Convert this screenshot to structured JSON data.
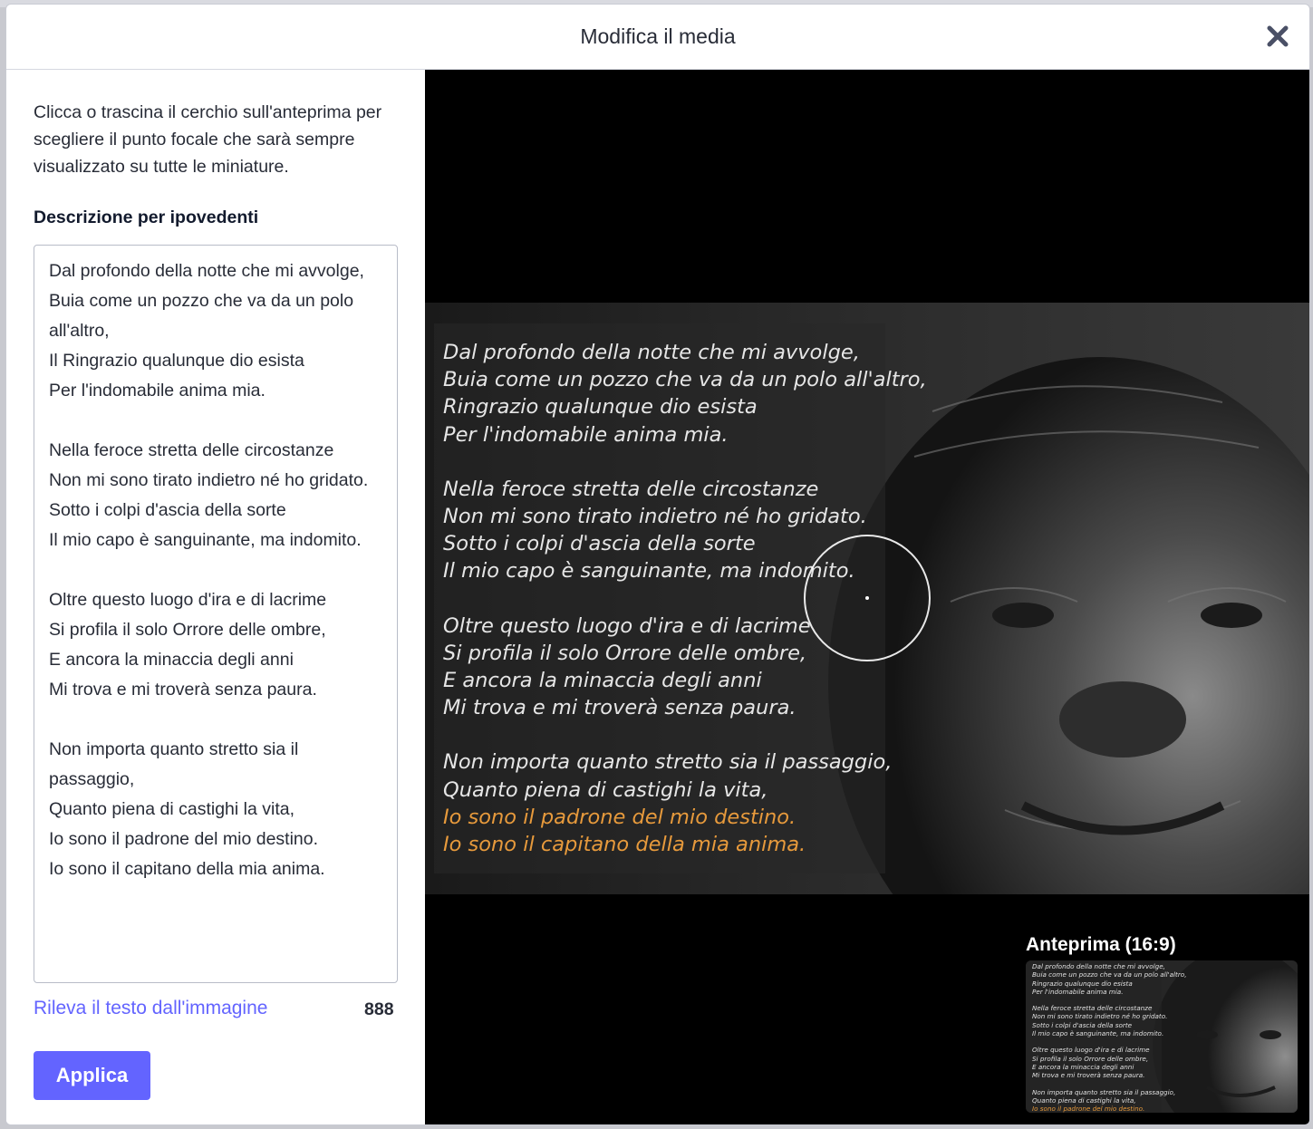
{
  "modal": {
    "title": "Modifica il media",
    "close_icon": "close-icon"
  },
  "left": {
    "hint": "Clicca o trascina il cerchio sull'anteprima per scegliere il punto focale che sarà sempre visualizzato su tutte le miniature.",
    "description_label": "Descrizione per ipovedenti",
    "description_value": "Dal profondo della notte che mi avvolge,\nBuia come un pozzo che va da un polo all'altro,\nIl Ringrazio qualunque dio esista\nPer l'indomabile anima mia.\n\nNella feroce stretta delle circostanze\nNon mi sono tirato indietro né ho gridato.\nSotto i colpi d'ascia della sorte\nIl mio capo è sanguinante, ma indomito.\n\nOltre questo luogo d'ira e di lacrime\nSi profila il solo Orrore delle ombre,\nE ancora la minaccia degli anni\nMi trova e mi troverà senza paura.\n\nNon importa quanto stretto sia il passaggio,\nQuanto piena di castighi la vita,\nIo sono il padrone del mio destino.\nIo sono il capitano della mia anima.",
    "detect_text_link": "Rileva il testo dall'immagine",
    "char_count": "888",
    "apply_button": "Applica"
  },
  "media": {
    "poem": {
      "s1": [
        "Dal profondo della notte che mi avvolge,",
        "Buia come un pozzo che va da un polo all'altro,",
        "Ringrazio qualunque dio esista",
        "Per l'indomabile anima mia."
      ],
      "s2": [
        "Nella feroce stretta delle circostanze",
        "Non mi sono tirato indietro né ho gridato.",
        "Sotto i colpi d'ascia della sorte",
        "Il mio capo è sanguinante, ma indomito."
      ],
      "s3": [
        "Oltre questo luogo d'ira e di lacrime",
        "Si profila il solo Orrore delle ombre,",
        "E ancora la minaccia degli anni",
        "Mi trova e mi troverà senza paura."
      ],
      "s4": [
        "Non importa quanto stretto sia il passaggio,",
        "Quanto piena di castighi la vita,",
        "Io sono il padrone del mio destino.",
        "Io sono il capitano della mia anima."
      ]
    },
    "highlight_color": "#e79a3c"
  },
  "preview": {
    "label": "Anteprima (16:9)"
  },
  "colors": {
    "accent": "#6364ff",
    "text": "#282c37"
  }
}
